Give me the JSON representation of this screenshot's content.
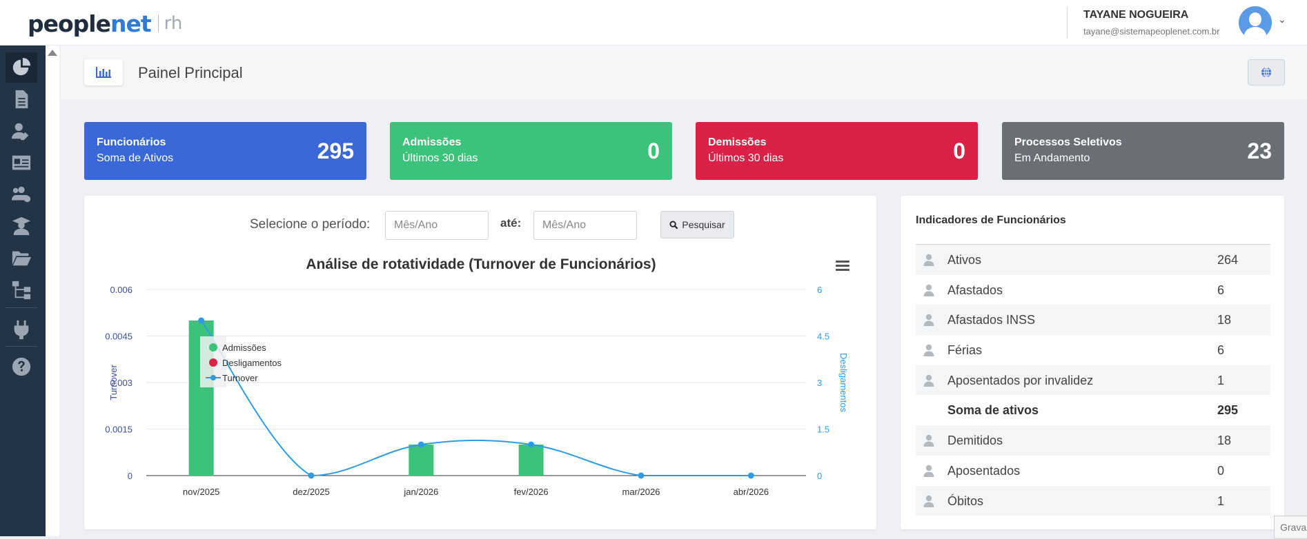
{
  "app": {
    "brand_people": "people",
    "brand_net": "net",
    "brand_rh": "rh"
  },
  "user": {
    "name": "TAYANE NOGUEIRA",
    "email": "tayane@sistemapeoplenet.com.br"
  },
  "sidebar": {
    "items": [
      {
        "icon": "pie-chart-icon",
        "active": true
      },
      {
        "icon": "document-icon"
      },
      {
        "icon": "user-edit-icon"
      },
      {
        "icon": "id-card-icon"
      },
      {
        "icon": "users-cog-icon"
      },
      {
        "icon": "graduate-icon"
      },
      {
        "icon": "folder-open-icon"
      },
      {
        "icon": "sitemap-icon"
      },
      {
        "icon": "plug-icon"
      },
      {
        "icon": "question-circle-icon"
      }
    ]
  },
  "page": {
    "title": "Painel Principal"
  },
  "cards": [
    {
      "title": "Funcionários",
      "subtitle": "Soma de Ativos",
      "value": "295",
      "color": "#3b68d8"
    },
    {
      "title": "Admissões",
      "subtitle": "Últimos 30 dias",
      "value": "0",
      "color": "#3cc27a"
    },
    {
      "title": "Demissões",
      "subtitle": "Últimos 30 dias",
      "value": "0",
      "color": "#da2148"
    },
    {
      "title": "Processos Seletivos",
      "subtitle": "Em Andamento",
      "value": "23",
      "color": "#6b6f75"
    }
  ],
  "filter": {
    "label": "Selecione o período:",
    "from_placeholder": "Mês/Ano",
    "to_label": "até:",
    "to_placeholder": "Mês/Ano",
    "search_label": "Pesquisar"
  },
  "chart_data": {
    "type": "bar",
    "title": "Análise de rotatividade (Turnover de Funcionários)",
    "categories": [
      "nov/2025",
      "dez/2025",
      "jan/2026",
      "fev/2026",
      "mar/2026",
      "abr/2026"
    ],
    "ylabel": "Turnover",
    "ylabel_right": "Desligamentos",
    "y_ticks": [
      "0",
      "0.0015",
      "0.003",
      "0.0045",
      "0.006"
    ],
    "y_right_ticks": [
      "0",
      "1.5",
      "3",
      "4.5",
      "6"
    ],
    "ylim": [
      0,
      0.006
    ],
    "ylim_right": [
      0,
      6
    ],
    "legend_position": "top-left",
    "series": [
      {
        "name": "Admissões",
        "type": "bar",
        "axis": "left",
        "color": "#3cc27a",
        "values": [
          0.005,
          0,
          0.001,
          0.001,
          0,
          0
        ]
      },
      {
        "name": "Desligamentos",
        "type": "bar",
        "axis": "right",
        "color": "#da2148",
        "values": [
          0,
          0,
          0,
          0,
          0,
          0
        ]
      },
      {
        "name": "Turnover",
        "type": "spline",
        "axis": "right",
        "color": "#2b9de8",
        "values": [
          5,
          0,
          1,
          1,
          0,
          0
        ]
      }
    ]
  },
  "indicators": {
    "title": "Indicadores de Funcionários",
    "rows": [
      {
        "label": "Ativos",
        "value": "264",
        "icon": true
      },
      {
        "label": "Afastados",
        "value": "6",
        "icon": true
      },
      {
        "label": "Afastados INSS",
        "value": "18",
        "icon": true
      },
      {
        "label": "Férias",
        "value": "6",
        "icon": true
      },
      {
        "label": "Aposentados por invalidez",
        "value": "1",
        "icon": true
      },
      {
        "label": "Soma de ativos",
        "value": "295",
        "icon": false,
        "bold": true
      },
      {
        "label": "Demitidos",
        "value": "18",
        "icon": true
      },
      {
        "label": "Aposentados",
        "value": "0",
        "icon": true
      },
      {
        "label": "Óbitos",
        "value": "1",
        "icon": true
      }
    ]
  },
  "footer": {
    "recaptcha_text": "Grava"
  }
}
